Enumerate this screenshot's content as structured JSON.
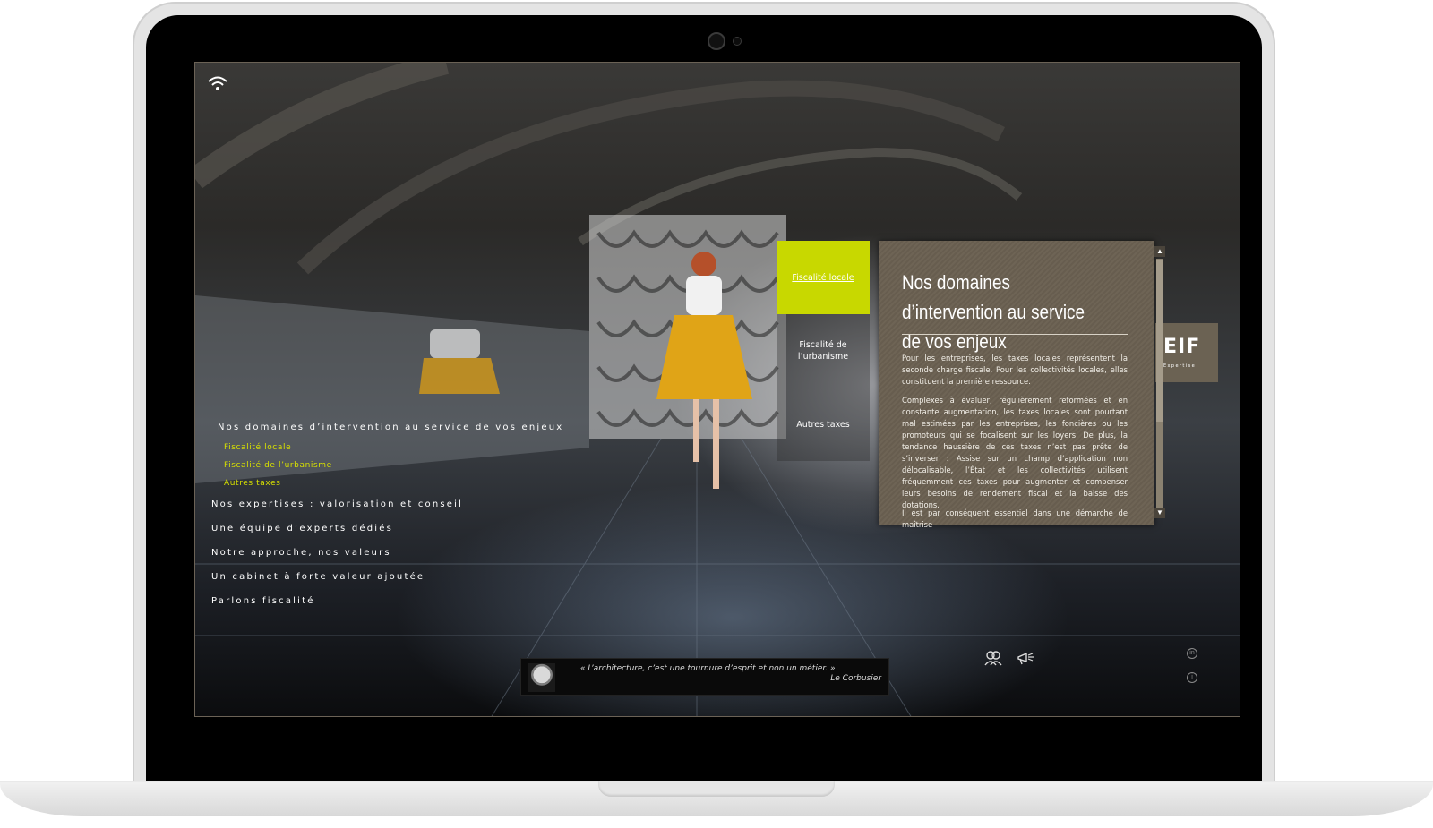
{
  "nav": {
    "main_item": "Nos domaines d’intervention au service de vos enjeux",
    "sub_items": [
      "Fiscalité locale",
      "Fiscalité de l’urbanisme",
      "Autres taxes"
    ],
    "items": [
      "Nos expertises : valorisation et conseil",
      "Une équipe d’experts dédiés",
      "Notre approche, nos valeurs",
      "Un cabinet à forte valeur ajoutée",
      "Parlons fiscalité"
    ]
  },
  "tabs": [
    "Fiscalité locale",
    "Fiscalité de l’urbanisme",
    "Autres taxes"
  ],
  "panel": {
    "title": "Nos domaines d’intervention au service de vos enjeux",
    "paragraphs": [
      "Pour les entreprises, les taxes locales représentent la seconde charge fiscale. Pour les collectivités locales, elles constituent la première ressource.",
      "Complexes à évaluer, régulièrement reformées et en constante augmentation, les taxes locales sont pourtant mal estimées par les entreprises, les foncières ou les promoteurs qui se focalisent sur les loyers. De plus, la tendance haussière de ces taxes n’est pas prête de s’inverser : Assise sur un champ d’application non délocalisable, l’État et les collectivités utilisent fréquemment ces taxes pour augmenter et compenser leurs besoins de rendement fiscal et la baisse des dotations.",
      "Il est par conséquent essentiel dans une démarche de maîtrise"
    ]
  },
  "logo": {
    "name": "EIF",
    "tagline": "Expertise"
  },
  "quote": {
    "text": "« L’architecture, c’est une tournure d’esprit et non un métier. »",
    "author": "Le Corbusier"
  },
  "icons": {
    "wifi": "wifi-icon",
    "team": "team-icon",
    "megaphone": "megaphone-icon",
    "linkedin": "linkedin-icon",
    "info": "info-icon"
  },
  "colors": {
    "accent": "#c8d800",
    "panel": "#6e6455",
    "nav_sub": "#d7e000"
  }
}
